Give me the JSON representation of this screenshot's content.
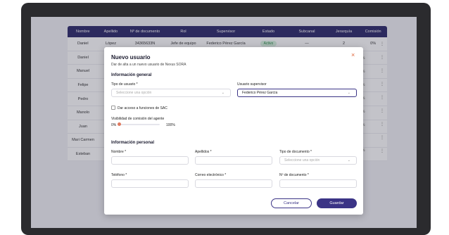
{
  "table": {
    "headers": [
      "Nombre",
      "Apellido",
      "Nº de documento",
      "Rol",
      "Supervisor",
      "Estado",
      "Subcanal",
      "Jerarquía",
      "Comisión"
    ],
    "first_row": [
      "Daniel",
      "López",
      "34365633N",
      "Jefe de equipo",
      "Federico Pérez García",
      "Activo",
      "—",
      "2",
      "0%"
    ],
    "names": [
      "Daniel",
      "Manuel",
      "Felipe",
      "Pedro",
      "Manolo",
      "Juan",
      "Mari Carmen",
      "Esteban"
    ],
    "commission_tail": [
      "%",
      "%",
      "%",
      "%",
      "%",
      "%",
      "%"
    ]
  },
  "modal": {
    "title": "Nuevo usuario",
    "subtitle": "Dar de alta a un nuevo usuario de Nexus SORA",
    "close_icon": "×",
    "general_section": "Información general",
    "user_type_label": "Tipo de usuario *",
    "user_type_placeholder": "Seleccione una opción",
    "supervisor_label": "Usuario supervisor",
    "supervisor_value": "Federico Pérez García",
    "sac_checkbox_label": "Dar acceso a funciones de SAC",
    "commission_visibility_label": "Visibilidad de comisión del agente",
    "slider_min": "0%",
    "slider_max": "100%",
    "slider_value_percent": 0,
    "personal_section": "Información personal",
    "name_label": "Nombre *",
    "surname_label": "Apellidos *",
    "doc_type_label": "Tipo de documento *",
    "doc_type_placeholder": "Seleccione una opción",
    "phone_label": "Teléfono *",
    "email_label": "Correo electrónico *",
    "doc_number_label": "Nº de documento *",
    "cancel_label": "Cancelar",
    "save_label": "Guardar"
  },
  "colors": {
    "accent": "#3b3486",
    "header": "#2f2b6b",
    "close": "#e0663a"
  }
}
